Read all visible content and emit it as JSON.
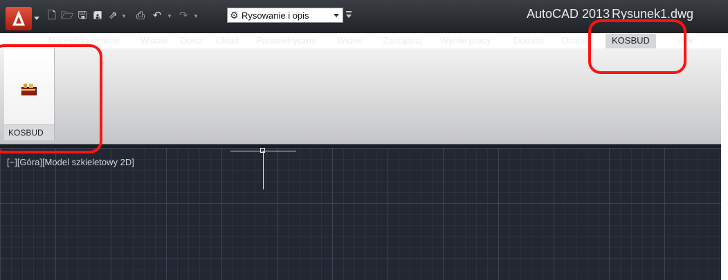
{
  "titlebar": {
    "workspace": "Rysowanie i opis",
    "app_name": "AutoCAD 2013",
    "document": "Rysunek1.dwg"
  },
  "icons": {
    "app_menu": "autocad-a-logo-icon",
    "quick_access": [
      "new-icon",
      "open-icon",
      "save-icon",
      "save-as-icon",
      "publish-icon",
      "plot-icon",
      "undo-icon",
      "redo-icon",
      "gear-icon"
    ]
  },
  "ribbon_tabs": [
    {
      "label": "Narzędzia główne"
    },
    {
      "label": "Wstaw"
    },
    {
      "label": "Opisz"
    },
    {
      "label": "Układ"
    },
    {
      "label": "Parametryczne"
    },
    {
      "label": "Widok"
    },
    {
      "label": "Zarządzaj"
    },
    {
      "label": "Wyniki pracy"
    },
    {
      "label": "Dodatki"
    },
    {
      "label": "Online"
    },
    {
      "label": "KOSBUD",
      "active": true
    }
  ],
  "ribbon": {
    "panel_label": "KOSBUD"
  },
  "viewport": {
    "label": "[−][Góra][Model szkieletowy 2D]"
  },
  "colors": {
    "annotation": "#ff1212",
    "viewport_bg": "#222732",
    "titlebar_bg": "#2b2f35"
  }
}
